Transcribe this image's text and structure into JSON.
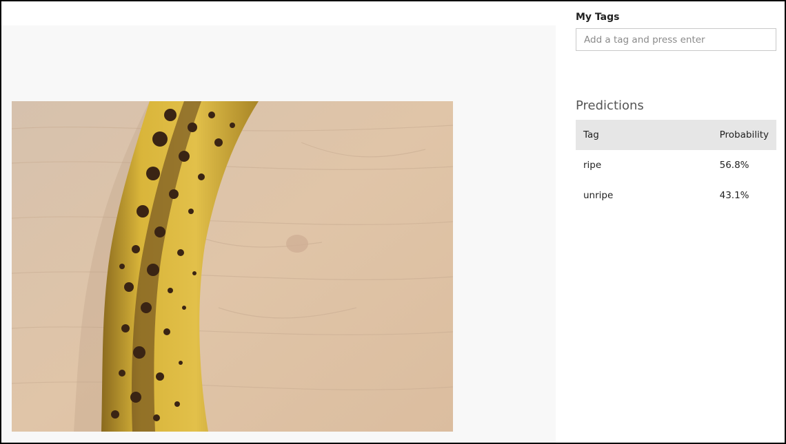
{
  "tags": {
    "label": "My Tags",
    "input_placeholder": "Add a tag and press enter",
    "input_value": ""
  },
  "predictions": {
    "heading": "Predictions",
    "columns": {
      "tag": "Tag",
      "probability": "Probability"
    },
    "rows": [
      {
        "tag": "ripe",
        "probability": "56.8%"
      },
      {
        "tag": "unripe",
        "probability": "43.1%"
      }
    ]
  },
  "image": {
    "subject": "banana-on-wood-table",
    "colors": {
      "wood": "#dcc2a8",
      "banana": "#d9b53a",
      "spots": "#3a2414",
      "pane_bg": "#f8f8f8"
    }
  }
}
